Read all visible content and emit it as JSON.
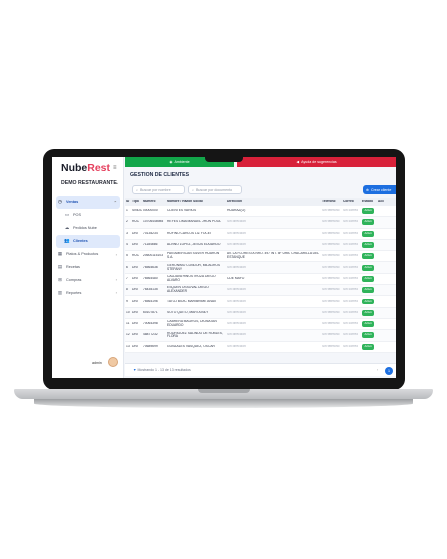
{
  "app": {
    "logo_main": "Nube",
    "logo_accent": "Rest",
    "restaurant": "DEMO RESTAURANTE"
  },
  "colors": {
    "accent": "#1d6fe0",
    "green": "#12a64a",
    "red": "#d8213a",
    "badge": "#2fb35a"
  },
  "sidebar": {
    "items": [
      {
        "label": "Ventas",
        "icon": "clock-icon",
        "active": false
      },
      {
        "label": "POS",
        "icon": "monitor-icon",
        "active": false
      },
      {
        "label": "Pedidos Nube",
        "icon": "cloud-icon",
        "active": false
      },
      {
        "label": "Clientes",
        "icon": "users-icon",
        "active": true
      },
      {
        "label": "Platos & Productos",
        "icon": "dish-icon",
        "active": false
      },
      {
        "label": "Recetas",
        "icon": "book-icon",
        "active": false
      },
      {
        "label": "Compras",
        "icon": "cart-icon",
        "active": false
      },
      {
        "label": "Reportes",
        "icon": "chart-icon",
        "active": false
      }
    ],
    "user": "admin"
  },
  "topbar": {
    "green_label": "Ambiente",
    "red_label": "Ayuda de sugerencias"
  },
  "main": {
    "title": "GESTION DE CLIENTES",
    "search_name_placeholder": "Buscar por nombre",
    "search_doc_placeholder": "Buscar por documento",
    "create_button": "Crear cliente"
  },
  "table": {
    "headers": [
      "ID",
      "Tipo",
      "Número",
      "Nombre / Razón Social",
      "Dirección",
      "Teléfono",
      "Correo",
      "Estado",
      "Acc"
    ],
    "rows": [
      {
        "id": "1",
        "tipo": "SINDOC",
        "numero": "00000000",
        "nombre": "CLIENTES VARIOS",
        "direccion": "HUARAZ(O)",
        "telefono": "Sin teléfono",
        "correo": "Sin correo",
        "estado": "Activo"
      },
      {
        "id": "2",
        "tipo": "RUC",
        "numero": "10706446985",
        "nombre": "REYES LIMA MANUEL JHON POOL",
        "direccion": "Sin dirección",
        "telefono": "Sin teléfono",
        "correo": "Sin correo",
        "estado": "Activo"
      },
      {
        "id": "3",
        "tipo": "DNI",
        "numero": "70135234",
        "nombre": "RUFINO CARLOS LIZ YOCEI",
        "direccion": "Sin dirección",
        "telefono": "Sin teléfono",
        "correo": "Sin correo",
        "estado": "Activo"
      },
      {
        "id": "4",
        "tipo": "DNI",
        "numero": "71184666",
        "nombre": "ALVINO LOPEZ, JESUS EDUARDO",
        "direccion": "Sin dirección",
        "telefono": "Sin teléfono",
        "correo": "Sin correo",
        "estado": "Activo"
      },
      {
        "id": "5",
        "tipo": "RUC",
        "numero": "20600115103",
        "nombre": "PAN AMERICAN SILVER HUARON S.A.",
        "direccion": "AV. LA FLORESTA NRO. 497 INT. 5F URB. CHACARILLA DEL ESTANQUE",
        "telefono": "Sin teléfono",
        "correo": "Sin correo",
        "estado": "Activo"
      },
      {
        "id": "6",
        "tipo": "DNI",
        "numero": "76564636",
        "nombre": "GERONIMO CONDOR, MILAGROS STEFANY",
        "direccion": "Sin dirección",
        "telefono": "Sin teléfono",
        "correo": "Sin correo",
        "estado": "Activo"
      },
      {
        "id": "7",
        "tipo": "DNI",
        "numero": "76564480",
        "nombre": "CALDAVA HINOSTROZA DIEGO ALVARO",
        "direccion": "CDE MAYO",
        "telefono": "Sin teléfono",
        "correo": "Sin correo",
        "estado": "Activo"
      },
      {
        "id": "8",
        "tipo": "DNI",
        "numero": "76435135",
        "nombre": "ESQUEN OSSOVAL DIEGO ALEXANDER",
        "direccion": "Sin dirección",
        "telefono": "Sin teléfono",
        "correo": "Sin correo",
        "estado": "Activo"
      },
      {
        "id": "9",
        "tipo": "DNI",
        "numero": "76564196",
        "nombre": "TATOJ BIOIC MARIBRIME ANAX",
        "direccion": "Sin dirección",
        "telefono": "Sin teléfono",
        "correo": "Sin correo",
        "estado": "Activo"
      },
      {
        "id": "10",
        "tipo": "DNI",
        "numero": "60107871",
        "nombre": "SOTO QUITO, MARTA BILY",
        "direccion": "Sin dirección",
        "telefono": "Sin teléfono",
        "correo": "Sin correo",
        "estado": "Activo"
      },
      {
        "id": "11",
        "tipo": "DNI",
        "numero": "70064398",
        "nombre": "CABRERA MAGROS, DIONATAN EDUARDO",
        "direccion": "Sin dirección",
        "telefono": "Sin teléfono",
        "correo": "Sin correo",
        "estado": "Activo"
      },
      {
        "id": "12",
        "tipo": "DNI",
        "numero": "48877232",
        "nombre": "RODRIGUEZ SALINDO DE ROBLES, FLORA",
        "direccion": "Sin dirección",
        "telefono": "Sin teléfono",
        "correo": "Sin correo",
        "estado": "Activo"
      },
      {
        "id": "13",
        "tipo": "DNI",
        "numero": "70689699",
        "nombre": "GONZALES VASQUEZ, OSCAR",
        "direccion": "Sin dirección",
        "telefono": "Sin teléfono",
        "correo": "Sin correo",
        "estado": "Activo"
      }
    ]
  },
  "footer": {
    "summary": "Mostrando 1 - 13 de 13 resultados",
    "page": "1"
  }
}
